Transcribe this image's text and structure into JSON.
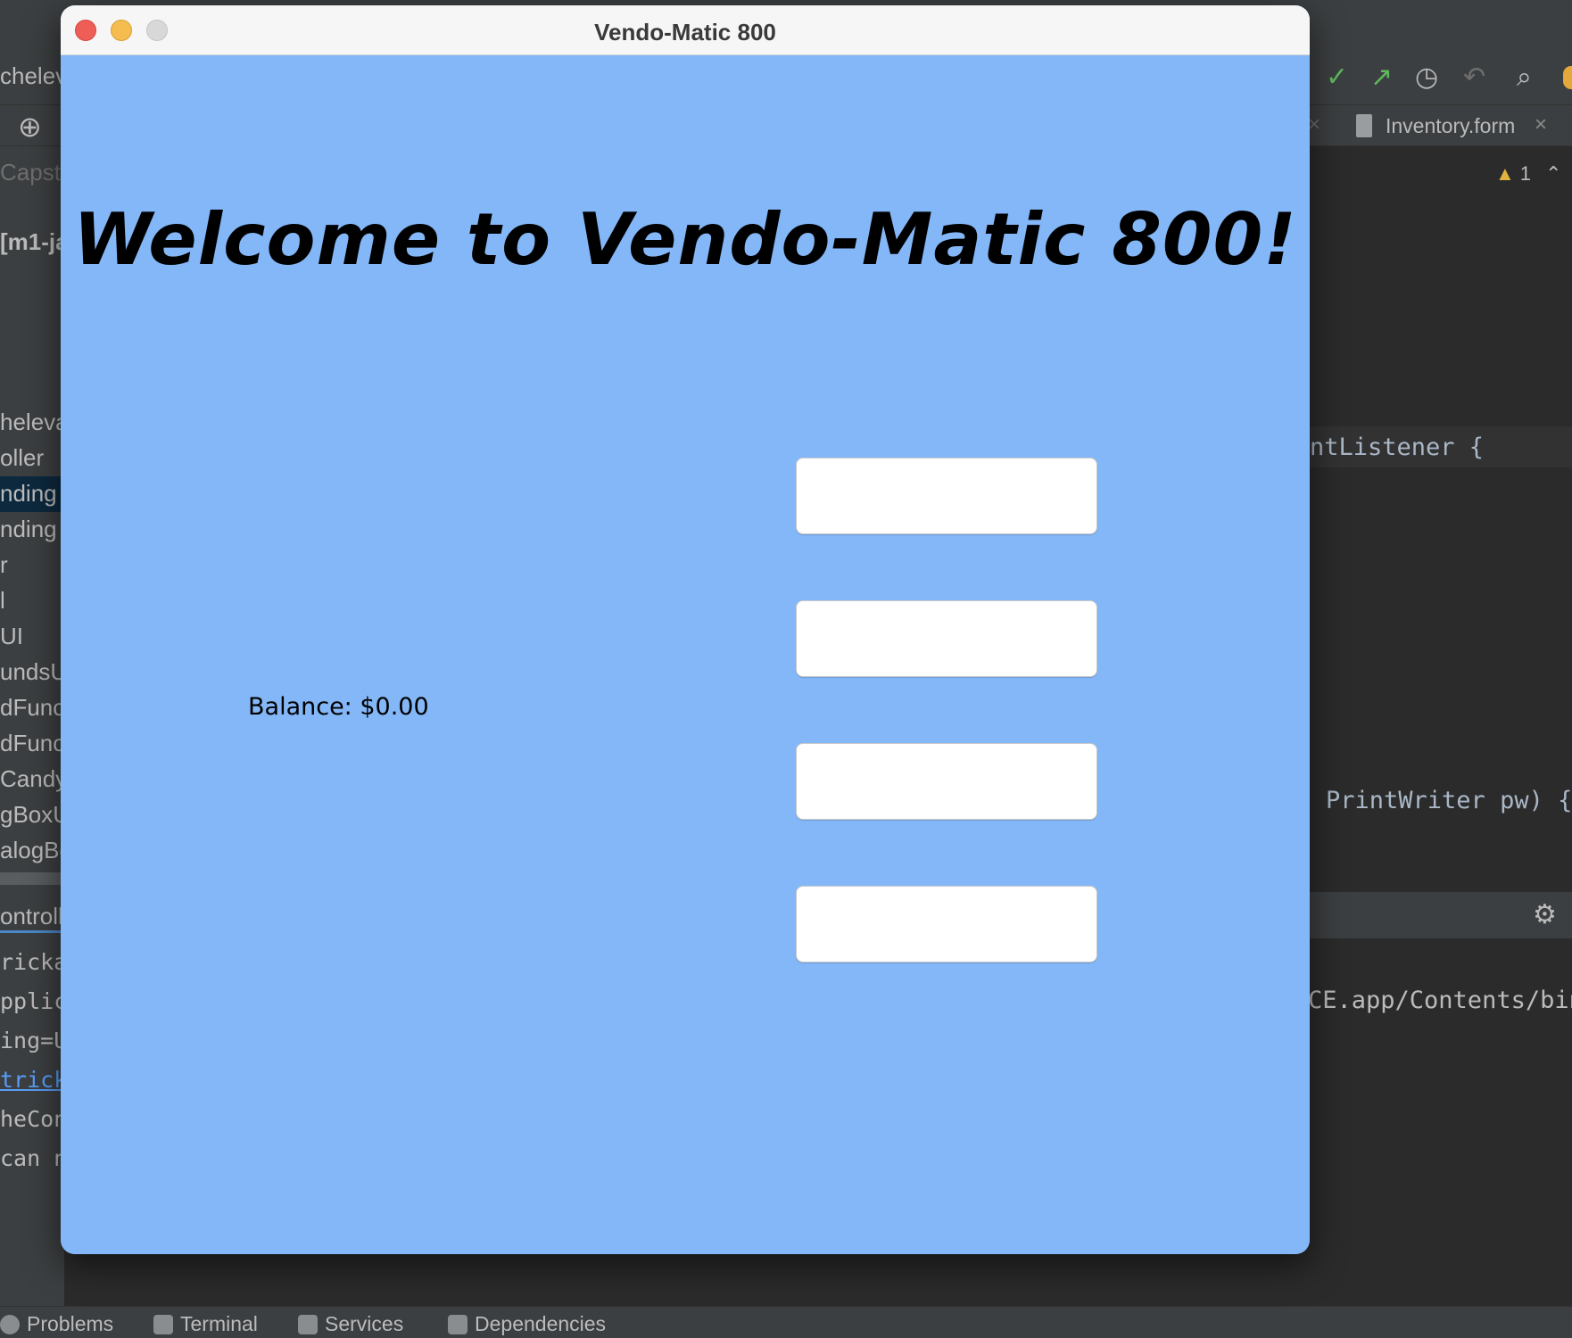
{
  "ide": {
    "project_fragment": "chelev",
    "tab_label": "Inventory.form",
    "left_tree_partial": [
      "Capst",
      "[m1-ja"
    ],
    "left_items": [
      "heleva",
      "oller",
      "nding",
      "nding",
      "r",
      "l",
      "UI",
      "undsU",
      "dFunc",
      "dFunc",
      "Candy",
      "gBoxU",
      "alogBo",
      "ontroll"
    ],
    "left_console": [
      "ricka",
      "pplic",
      "ing=U",
      "trick",
      "heCon",
      "can n"
    ],
    "warning_count": "1",
    "code_line_1": "ntListener {",
    "code_line_2": "PrintWriter pw) {",
    "console_line": "CE.app/Contents/bin",
    "bottom_tabs": [
      "Problems",
      "Terminal",
      "Services",
      "Dependencies"
    ]
  },
  "window": {
    "title": "Vendo-Matic 800",
    "welcome": "Welcome to Vendo-Matic 800!",
    "balance": "Balance: $0.00",
    "buttons": [
      "",
      "",
      "",
      ""
    ]
  },
  "colors": {
    "window_bg": "#84b7f7",
    "ide_bg": "#2b2b2b"
  }
}
